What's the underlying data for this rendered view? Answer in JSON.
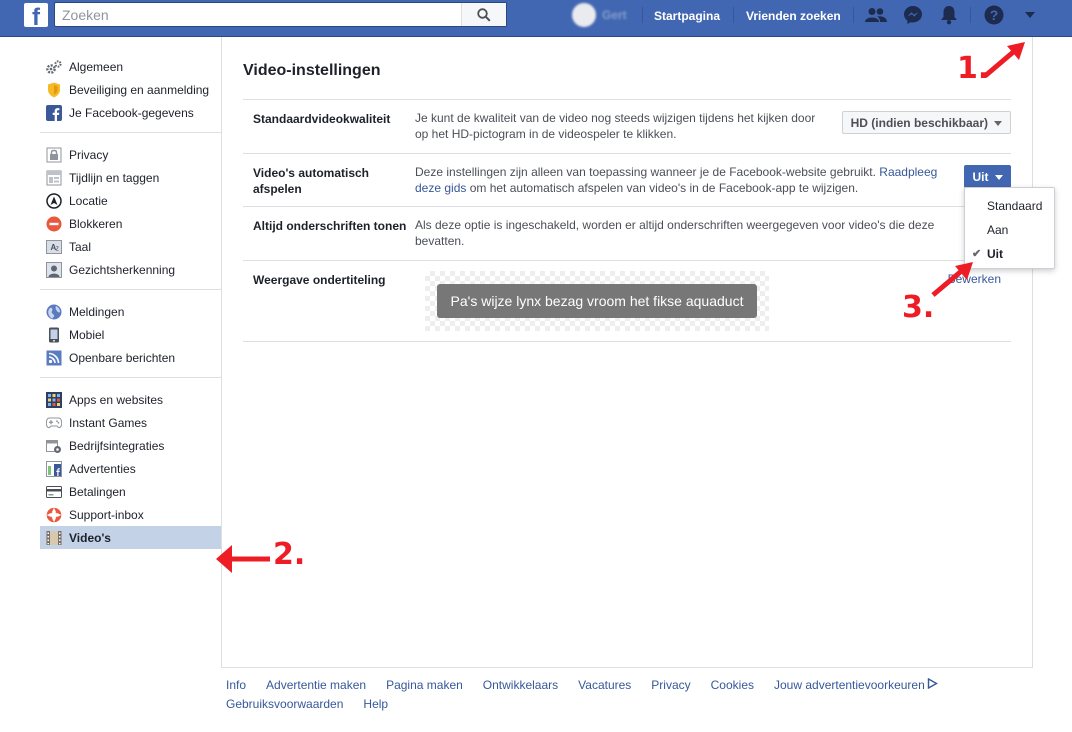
{
  "header": {
    "search_placeholder": "Zoeken",
    "profile_name": "Gert",
    "nav_home": "Startpagina",
    "nav_friends": "Vrienden zoeken"
  },
  "sidebar": {
    "groups": [
      {
        "items": [
          {
            "label": "Algemeen",
            "icon": "gears-icon"
          },
          {
            "label": "Beveiliging en aanmelding",
            "icon": "shield-icon"
          },
          {
            "label": "Je Facebook-gegevens",
            "icon": "facebook-icon"
          }
        ]
      },
      {
        "items": [
          {
            "label": "Privacy",
            "icon": "lock-icon"
          },
          {
            "label": "Tijdlijn en taggen",
            "icon": "timeline-icon"
          },
          {
            "label": "Locatie",
            "icon": "location-icon"
          },
          {
            "label": "Blokkeren",
            "icon": "block-icon"
          },
          {
            "label": "Taal",
            "icon": "language-icon"
          },
          {
            "label": "Gezichtsherkenning",
            "icon": "face-icon"
          }
        ]
      },
      {
        "items": [
          {
            "label": "Meldingen",
            "icon": "globe-icon"
          },
          {
            "label": "Mobiel",
            "icon": "mobile-icon"
          },
          {
            "label": "Openbare berichten",
            "icon": "rss-icon"
          }
        ]
      },
      {
        "items": [
          {
            "label": "Apps en websites",
            "icon": "apps-icon"
          },
          {
            "label": "Instant Games",
            "icon": "gamepad-icon"
          },
          {
            "label": "Bedrijfsintegraties",
            "icon": "business-icon"
          },
          {
            "label": "Advertenties",
            "icon": "ads-icon"
          },
          {
            "label": "Betalingen",
            "icon": "card-icon"
          },
          {
            "label": "Support-inbox",
            "icon": "lifebuoy-icon"
          },
          {
            "label": "Video's",
            "icon": "film-icon",
            "active": true
          }
        ]
      }
    ]
  },
  "main": {
    "title": "Video-instellingen",
    "rows": {
      "quality": {
        "label": "Standaardvideokwaliteit",
        "desc_line1": "Je kunt de kwaliteit van de video nog steeds wijzigen tijdens het kijken door",
        "desc_line2": "op het HD-pictogram in de videospeler te klikken.",
        "select_value": "HD (indien beschikbaar)"
      },
      "autoplay": {
        "label_line1": "Video's automatisch",
        "label_line2": "afspelen",
        "desc_line1_a": "Deze instellingen zijn alleen van toepassing wanneer je de Facebook-website gebruikt. ",
        "desc_line1_link": "Raadpleeg",
        "desc_line2_link": "deze gids",
        "desc_line2_b": " om het automatisch afspelen van video's in de Facebook-app te wijzigen.",
        "button_value": "Uit"
      },
      "captions": {
        "label": "Altijd onderschriften tonen",
        "desc_line1": "Als deze optie is ingeschakeld, worden er altijd onderschriften weergegeven voor video's die deze",
        "desc_line2": "bevatten."
      },
      "subtitle_display": {
        "label": "Weergave ondertiteling",
        "preview_text": "Pa's wijze lynx bezag vroom het fikse aquaduct",
        "edit_link": "Bewerken"
      }
    },
    "dropdown": {
      "options": [
        "Standaard",
        "Aan",
        "Uit"
      ],
      "selected": "Uit"
    }
  },
  "footer": {
    "links": [
      "Info",
      "Advertentie maken",
      "Pagina maken",
      "Ontwikkelaars",
      "Vacatures",
      "Privacy",
      "Cookies",
      "Jouw advertentievoorkeuren"
    ],
    "links_row2": [
      "Gebruiksvoorwaarden",
      "Help"
    ]
  },
  "annotations": [
    "1.",
    "2.",
    "3."
  ]
}
